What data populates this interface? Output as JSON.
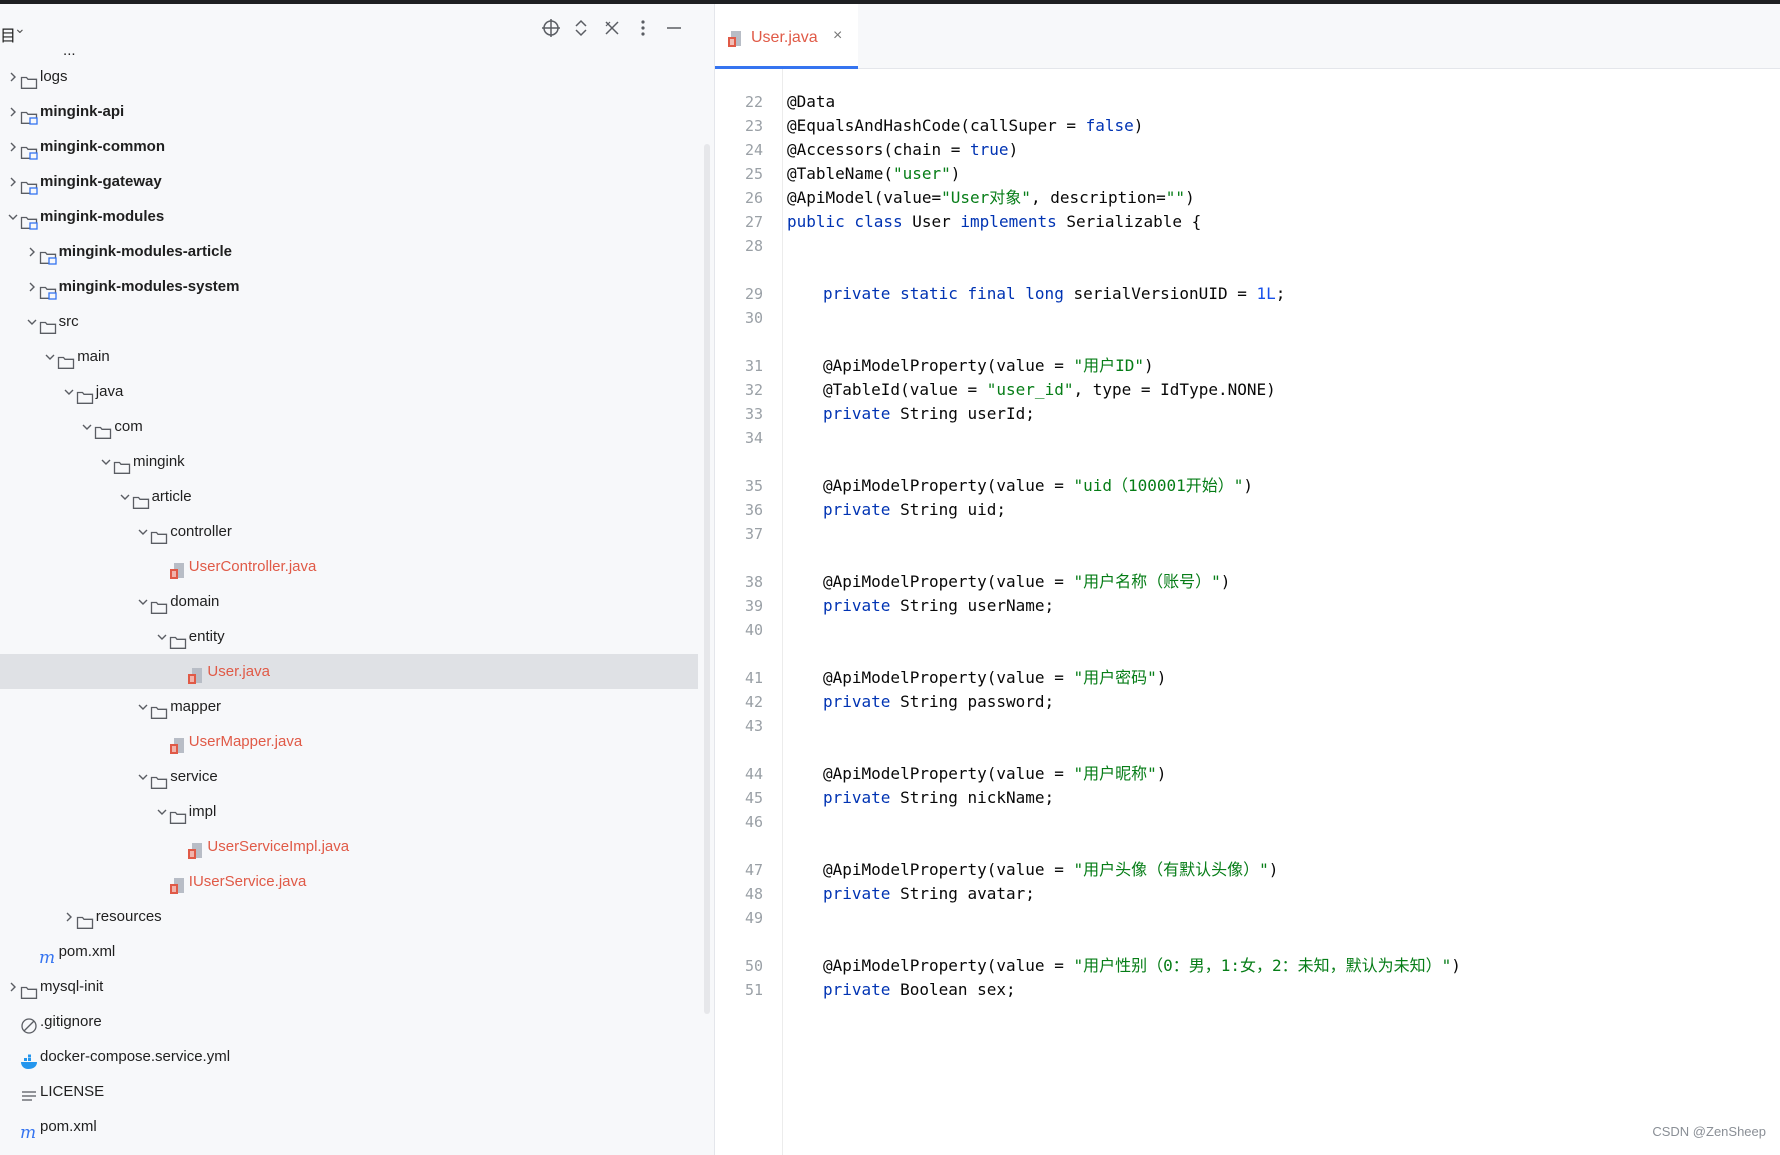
{
  "project": {
    "title_fragment": "目",
    "header_icons": [
      "locate-icon",
      "expand-collapse-icon",
      "close-icon",
      "more-options-icon",
      "minimize-icon"
    ],
    "clipped_top_text": "___...__",
    "tree": [
      {
        "label": "logs",
        "indent": 0,
        "type": "folder",
        "chevron": "right",
        "bold": false
      },
      {
        "label": "mingink-api",
        "indent": 0,
        "type": "module",
        "chevron": "right",
        "bold": true
      },
      {
        "label": "mingink-common",
        "indent": 0,
        "type": "module",
        "chevron": "right",
        "bold": true
      },
      {
        "label": "mingink-gateway",
        "indent": 0,
        "type": "module",
        "chevron": "right",
        "bold": true
      },
      {
        "label": "mingink-modules",
        "indent": 0,
        "type": "module",
        "chevron": "down",
        "bold": true
      },
      {
        "label": "mingink-modules-article",
        "indent": 1,
        "type": "module",
        "chevron": "right",
        "bold": true
      },
      {
        "label": "mingink-modules-system",
        "indent": 1,
        "type": "module",
        "chevron": "right",
        "bold": true
      },
      {
        "label": "src",
        "indent": 1,
        "type": "folder",
        "chevron": "down",
        "bold": false
      },
      {
        "label": "main",
        "indent": 2,
        "type": "folder",
        "chevron": "down",
        "bold": false
      },
      {
        "label": "java",
        "indent": 3,
        "type": "folder",
        "chevron": "down",
        "bold": false
      },
      {
        "label": "com",
        "indent": 4,
        "type": "folder",
        "chevron": "down",
        "bold": false
      },
      {
        "label": "mingink",
        "indent": 5,
        "type": "folder",
        "chevron": "down",
        "bold": false
      },
      {
        "label": "article",
        "indent": 6,
        "type": "folder",
        "chevron": "down",
        "bold": false
      },
      {
        "label": "controller",
        "indent": 7,
        "type": "folder",
        "chevron": "down",
        "bold": false
      },
      {
        "label": "UserController.java",
        "indent": 8,
        "type": "java",
        "chevron": "",
        "bold": false
      },
      {
        "label": "domain",
        "indent": 7,
        "type": "folder",
        "chevron": "down",
        "bold": false
      },
      {
        "label": "entity",
        "indent": 8,
        "type": "folder",
        "chevron": "down",
        "bold": false
      },
      {
        "label": "User.java",
        "indent": 9,
        "type": "java",
        "chevron": "",
        "bold": false,
        "selected": true
      },
      {
        "label": "mapper",
        "indent": 7,
        "type": "folder",
        "chevron": "down",
        "bold": false
      },
      {
        "label": "UserMapper.java",
        "indent": 8,
        "type": "java",
        "chevron": "",
        "bold": false
      },
      {
        "label": "service",
        "indent": 7,
        "type": "folder",
        "chevron": "down",
        "bold": false
      },
      {
        "label": "impl",
        "indent": 8,
        "type": "folder",
        "chevron": "down",
        "bold": false
      },
      {
        "label": "UserServiceImpl.java",
        "indent": 9,
        "type": "java",
        "chevron": "",
        "bold": false
      },
      {
        "label": "IUserService.java",
        "indent": 8,
        "type": "java",
        "chevron": "",
        "bold": false
      },
      {
        "label": "resources",
        "indent": 3,
        "type": "folder",
        "chevron": "right",
        "bold": false
      },
      {
        "label": "pom.xml",
        "indent": 1,
        "type": "maven",
        "chevron": "",
        "bold": false
      },
      {
        "label": "mysql-init",
        "indent": 0,
        "type": "folder",
        "chevron": "right",
        "bold": false
      },
      {
        "label": ".gitignore",
        "indent": 0,
        "type": "ignore",
        "chevron": "",
        "bold": false
      },
      {
        "label": "docker-compose.service.yml",
        "indent": 0,
        "type": "docker",
        "chevron": "",
        "bold": false
      },
      {
        "label": "LICENSE",
        "indent": 0,
        "type": "text",
        "chevron": "",
        "bold": false
      },
      {
        "label": "pom.xml",
        "indent": 0,
        "type": "maven",
        "chevron": "",
        "bold": false
      }
    ]
  },
  "editor": {
    "tab": {
      "label": "User.java",
      "close": "×"
    },
    "lines": [
      {
        "n": "22",
        "pad": 0,
        "tokens": [
          [
            "@Data",
            ""
          ]
        ]
      },
      {
        "n": "23",
        "pad": 0,
        "tokens": [
          [
            "@EqualsAndHashCode(callSuper = ",
            ""
          ],
          [
            "false",
            "kw"
          ],
          [
            ")",
            ""
          ]
        ]
      },
      {
        "n": "24",
        "pad": 0,
        "tokens": [
          [
            "@Accessors(chain = ",
            ""
          ],
          [
            "true",
            "kw"
          ],
          [
            ")",
            ""
          ]
        ]
      },
      {
        "n": "25",
        "pad": 0,
        "tokens": [
          [
            "@TableName(",
            ""
          ],
          [
            "\"user\"",
            "str"
          ],
          [
            ")",
            ""
          ]
        ]
      },
      {
        "n": "26",
        "pad": 0,
        "tokens": [
          [
            "@ApiModel(value=",
            ""
          ],
          [
            "\"User对象\"",
            "str"
          ],
          [
            ", description=",
            ""
          ],
          [
            "\"\"",
            "str"
          ],
          [
            ")",
            ""
          ]
        ]
      },
      {
        "n": "27",
        "pad": 0,
        "tokens": [
          [
            "public class ",
            "kw"
          ],
          [
            "User ",
            ""
          ],
          [
            "implements ",
            "kw"
          ],
          [
            "Serializable {",
            ""
          ]
        ]
      },
      {
        "n": "28",
        "pad": 0,
        "tokens": []
      },
      {
        "n": "29",
        "pad": 1,
        "tokens": [
          [
            "private static final long ",
            "kw"
          ],
          [
            "serialVersionUID = ",
            ""
          ],
          [
            "1L",
            "num"
          ],
          [
            ";",
            ""
          ]
        ]
      },
      {
        "n": "30",
        "pad": 0,
        "tokens": []
      },
      {
        "n": "31",
        "pad": 1,
        "tokens": [
          [
            "@ApiModelProperty(value = ",
            ""
          ],
          [
            "\"用户ID\"",
            "str"
          ],
          [
            ")",
            ""
          ]
        ]
      },
      {
        "n": "32",
        "pad": 1,
        "tokens": [
          [
            "@TableId(value = ",
            ""
          ],
          [
            "\"user_id\"",
            "str"
          ],
          [
            ", type = IdType.NONE)",
            ""
          ]
        ]
      },
      {
        "n": "33",
        "pad": 1,
        "tokens": [
          [
            "private ",
            "kw"
          ],
          [
            "String userId;",
            ""
          ]
        ]
      },
      {
        "n": "34",
        "pad": 0,
        "tokens": []
      },
      {
        "n": "35",
        "pad": 1,
        "tokens": [
          [
            "@ApiModelProperty(value = ",
            ""
          ],
          [
            "\"uid（100001开始）\"",
            "str"
          ],
          [
            ")",
            ""
          ]
        ]
      },
      {
        "n": "36",
        "pad": 1,
        "tokens": [
          [
            "private ",
            "kw"
          ],
          [
            "String uid;",
            ""
          ]
        ]
      },
      {
        "n": "37",
        "pad": 0,
        "tokens": []
      },
      {
        "n": "38",
        "pad": 1,
        "tokens": [
          [
            "@ApiModelProperty(value = ",
            ""
          ],
          [
            "\"用户名称（账号）\"",
            "str"
          ],
          [
            ")",
            ""
          ]
        ]
      },
      {
        "n": "39",
        "pad": 1,
        "tokens": [
          [
            "private ",
            "kw"
          ],
          [
            "String userName;",
            ""
          ]
        ]
      },
      {
        "n": "40",
        "pad": 0,
        "tokens": []
      },
      {
        "n": "41",
        "pad": 1,
        "tokens": [
          [
            "@ApiModelProperty(value = ",
            ""
          ],
          [
            "\"用户密码\"",
            "str"
          ],
          [
            ")",
            ""
          ]
        ]
      },
      {
        "n": "42",
        "pad": 1,
        "tokens": [
          [
            "private ",
            "kw"
          ],
          [
            "String password;",
            ""
          ]
        ]
      },
      {
        "n": "43",
        "pad": 0,
        "tokens": []
      },
      {
        "n": "44",
        "pad": 1,
        "tokens": [
          [
            "@ApiModelProperty(value = ",
            ""
          ],
          [
            "\"用户昵称\"",
            "str"
          ],
          [
            ")",
            ""
          ]
        ]
      },
      {
        "n": "45",
        "pad": 1,
        "tokens": [
          [
            "private ",
            "kw"
          ],
          [
            "String nickName;",
            ""
          ]
        ]
      },
      {
        "n": "46",
        "pad": 0,
        "tokens": []
      },
      {
        "n": "47",
        "pad": 1,
        "tokens": [
          [
            "@ApiModelProperty(value = ",
            ""
          ],
          [
            "\"用户头像（有默认头像）\"",
            "str"
          ],
          [
            ")",
            ""
          ]
        ]
      },
      {
        "n": "48",
        "pad": 1,
        "tokens": [
          [
            "private ",
            "kw"
          ],
          [
            "String avatar;",
            ""
          ]
        ]
      },
      {
        "n": "49",
        "pad": 0,
        "tokens": []
      },
      {
        "n": "50",
        "pad": 1,
        "tokens": [
          [
            "@ApiModelProperty(value = ",
            ""
          ],
          [
            "\"用户性别（0：男，1:女，2：未知，默认为未知）\"",
            "str"
          ],
          [
            ")",
            ""
          ]
        ]
      },
      {
        "n": "51",
        "pad": 1,
        "tokens": [
          [
            "private ",
            "kw"
          ],
          [
            "Boolean sex;",
            ""
          ]
        ]
      }
    ]
  },
  "watermark": "CSDN @ZenSheep",
  "colors": {
    "accent": "#3574f0",
    "keyword": "#0033b3",
    "string": "#067d17",
    "number": "#1750eb",
    "java_file": "#e05a47",
    "selection": "#dfe1e5"
  }
}
